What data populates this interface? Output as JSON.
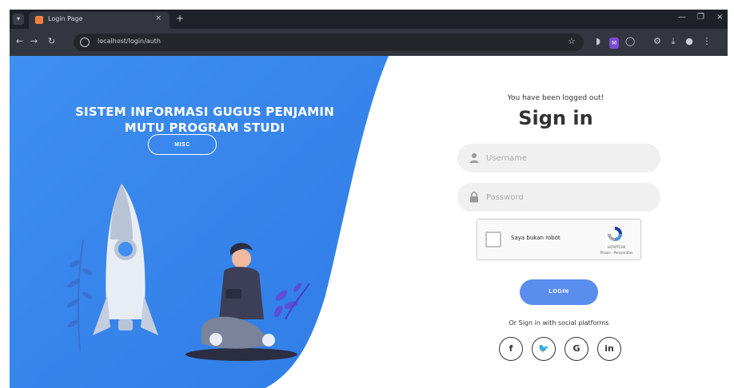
{
  "browser": {
    "tab_title": "Login Page",
    "tab_close": "×",
    "new_tab": "+",
    "url": "localhost/login/auth",
    "window_controls": [
      "—",
      "❐",
      "×"
    ],
    "menu_icon": "▾"
  },
  "hero": {
    "title_line1": "SISTEM INFORMASI GUGUS PENJAMIN",
    "title_line2": "MUTU PROGRAM STUDI",
    "button_label": "MISC"
  },
  "form": {
    "logged_out_message": "You have been logged out!",
    "title": "Sign in",
    "username_placeholder": "Username",
    "password_placeholder": "Password",
    "captcha_label": "Saya bukan robot",
    "captcha_brand": "reCAPTCHA",
    "captcha_terms": "Privasi - Persyaratan",
    "login_label": "LOGIN",
    "social_text": "Or Sign in with social platforms",
    "social_icons": [
      "f",
      "🐦",
      "G",
      "in"
    ]
  },
  "colors": {
    "accent": "#5b8def",
    "hero_blue": "#3f8ef0",
    "chrome_dark": "#1f2128",
    "chrome_toolbar": "#33363e"
  }
}
